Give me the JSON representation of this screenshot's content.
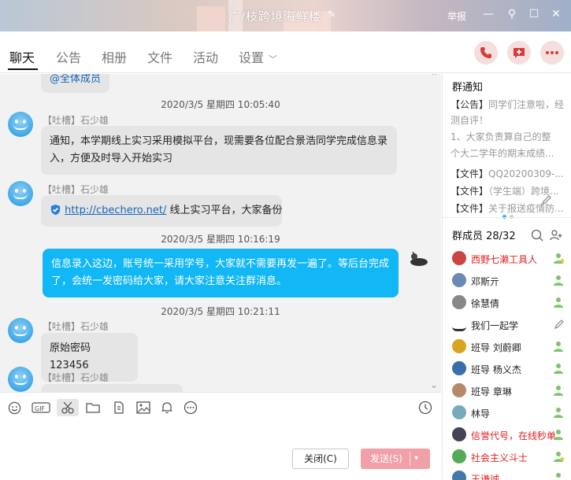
{
  "window": {
    "title": "广/枝跨境海鲜楼",
    "report_label": "举报",
    "btn_min": "—",
    "btn_max": "☐",
    "btn_close": "✕",
    "btn_pin": "⚲"
  },
  "tabs": [
    {
      "label": "聊天"
    },
    {
      "label": "公告"
    },
    {
      "label": "相册"
    },
    {
      "label": "文件"
    },
    {
      "label": "活动"
    },
    {
      "label": "设置"
    }
  ],
  "chat": {
    "partial_top": "@全体成员",
    "messages": [
      {
        "time": "2020/3/5 星期四 10:05:40",
        "sender": "【吐槽】石少雄",
        "text_line1": "通知，本学期线上实习采用模拟平台，现需要各位配合景浩同学完成信息录",
        "text_line2": "入，方便及时导入开始实习"
      },
      {
        "sender": "【吐槽】石少雄",
        "link": "http://cbechero.net/",
        "text": " 线上实习平台，大家备份"
      },
      {
        "time": "2020/3/5 星期四 10:16:19",
        "text_line1": "信息录入这边，账号统一采用学号，大家就不需要再发一遍了。等后台完成",
        "text_line2": "了，会统一发密码给大家，请大家注意关注群消息。"
      },
      {
        "time": "2020/3/5 星期四 10:21:11",
        "sender": "【吐槽】石少雄",
        "text": "原始密码123456"
      },
      {
        "sender": "【吐槽】石少雄"
      }
    ]
  },
  "input": {
    "close_label": "关闭(C)",
    "send_label": "发送(S)"
  },
  "right": {
    "notice_title": "群通知",
    "notices": [
      {
        "tag": "【公告】",
        "text": "同学们注意啦，经"
      },
      {
        "tag": "",
        "text": "测自评！"
      },
      {
        "tag": "",
        "text": "1、大家负责算自己的整"
      },
      {
        "tag": "",
        "text": "个大二学年的期末成绩..."
      },
      {
        "tag": "【文件】",
        "text": "QQ20200309-..."
      },
      {
        "tag": "【文件】",
        "text": "（学生端）跨境..."
      },
      {
        "tag": "【文件】",
        "text": "关于报送疫情防..."
      }
    ],
    "members_title": "群成员 28/32",
    "members": [
      {
        "name": "西野七濑工具人",
        "red": true,
        "color": "#c44"
      },
      {
        "name": "邓斯亓",
        "red": false,
        "color": "#6a8ab5"
      },
      {
        "name": "徐慧倩",
        "red": false,
        "color": "#888"
      },
      {
        "name": "我们一起学",
        "red": false,
        "color": "#fff"
      },
      {
        "name": "班导 刘蔚卿",
        "red": false,
        "color": "#d9a520"
      },
      {
        "name": "班导 杨义杰",
        "red": false,
        "color": "#3a6ea8"
      },
      {
        "name": "班导 章琳",
        "red": false,
        "color": "#b58a6a"
      },
      {
        "name": "林导",
        "red": false,
        "color": "#7ab"
      },
      {
        "name": "信誉代号，在线秒单",
        "red": true,
        "color": "#445"
      },
      {
        "name": "社会主义斗士",
        "red": true,
        "color": "#5a5"
      },
      {
        "name": "王谦诚",
        "red": true,
        "color": "#4477aa"
      }
    ]
  },
  "colors": {
    "accent": "#12b7f5",
    "send_button": "#f1a0a8",
    "bubble_other": "#e5e5e5"
  }
}
